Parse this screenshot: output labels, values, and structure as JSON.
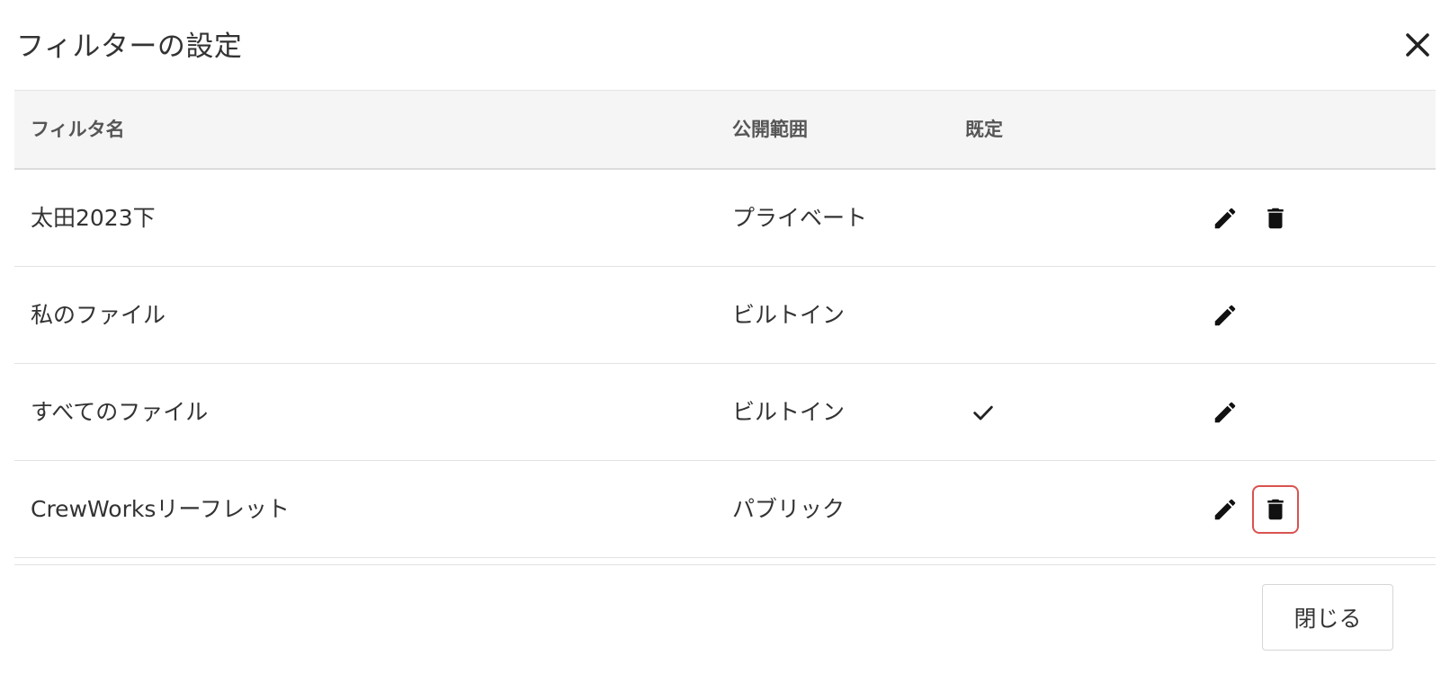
{
  "dialog": {
    "title": "フィルターの設定",
    "close_icon": "close-icon"
  },
  "table": {
    "headers": {
      "name": "フィルタ名",
      "scope": "公開範囲",
      "default": "既定"
    },
    "rows": [
      {
        "name": "太田2023下",
        "scope": "プライベート",
        "default": false,
        "actions": [
          "edit",
          "delete"
        ]
      },
      {
        "name": "私のファイル",
        "scope": "ビルトイン",
        "default": false,
        "actions": [
          "edit"
        ]
      },
      {
        "name": "すべてのファイル",
        "scope": "ビルトイン",
        "default": true,
        "actions": [
          "edit"
        ]
      },
      {
        "name": "CrewWorksリーフレット",
        "scope": "パブリック",
        "default": false,
        "actions": [
          "edit",
          "delete"
        ],
        "delete_highlighted": true
      }
    ]
  },
  "footer": {
    "close_label": "閉じる"
  },
  "colors": {
    "header_bg": "#f5f5f5",
    "highlight": "#d9534f",
    "text": "#333333"
  }
}
